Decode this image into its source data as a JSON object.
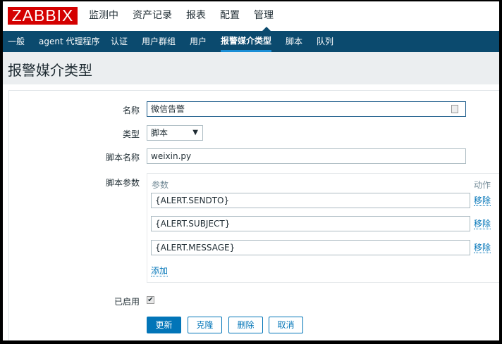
{
  "logo": "ZABBIX",
  "top_menu": [
    "监测中",
    "资产记录",
    "报表",
    "配置",
    "管理"
  ],
  "sub_menu": [
    "一般",
    "agent 代理程序",
    "认证",
    "用户群组",
    "用户",
    "报警媒介类型",
    "脚本",
    "队列"
  ],
  "active_sub": "报警媒介类型",
  "page_title": "报警媒介类型",
  "form": {
    "name_label": "名称",
    "name_value": "微信告警",
    "type_label": "类型",
    "type_value": "脚本",
    "script_name_label": "脚本名称",
    "script_name_value": "weixin.py",
    "params_label": "脚本参数",
    "params_header": "参数",
    "action_header": "动作",
    "params": [
      {
        "value": "{ALERT.SENDTO}",
        "remove": "移除"
      },
      {
        "value": "{ALERT.SUBJECT}",
        "remove": "移除"
      },
      {
        "value": "{ALERT.MESSAGE}",
        "remove": "移除"
      }
    ],
    "add_label": "添加",
    "enabled_label": "已启用",
    "enabled": true
  },
  "buttons": {
    "update": "更新",
    "clone": "克隆",
    "delete": "删除",
    "cancel": "取消"
  }
}
